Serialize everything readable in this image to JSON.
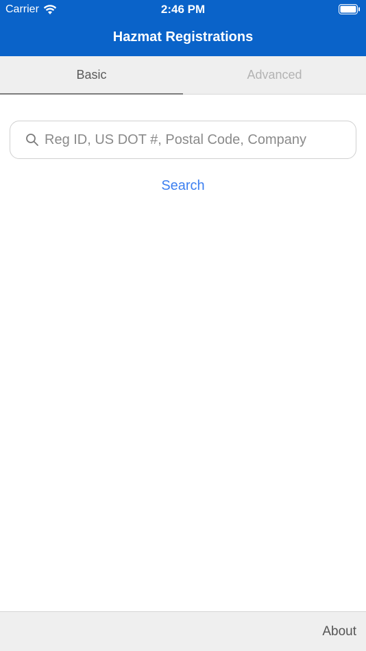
{
  "status_bar": {
    "carrier": "Carrier",
    "time": "2:46 PM",
    "icons": [
      "wifi-icon",
      "battery-icon"
    ]
  },
  "nav": {
    "title": "Hazmat Registrations"
  },
  "tabs": [
    {
      "label": "Basic",
      "active": true
    },
    {
      "label": "Advanced",
      "active": false
    }
  ],
  "search": {
    "placeholder": "Reg ID, US DOT #, Postal Code, Company",
    "value": "",
    "icon": "search-icon",
    "button_label": "Search"
  },
  "toolbar": {
    "about_label": "About"
  },
  "colors": {
    "nav_background": "#0a63c9",
    "link_blue": "#3c7ff0",
    "tab_bar_background": "#efefef"
  }
}
